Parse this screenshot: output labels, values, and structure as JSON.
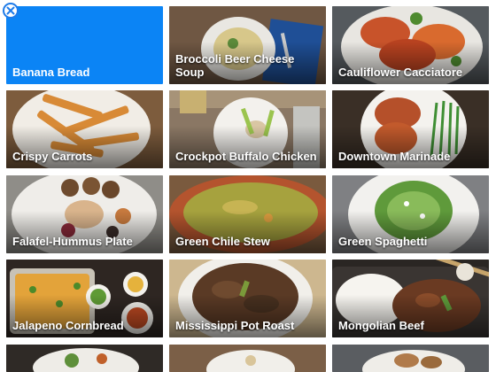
{
  "close_icon_name": "close-icon",
  "accent_color": "#0b84f5",
  "recipes": [
    {
      "label": "Banana Bread"
    },
    {
      "label": "Broccoli Beer Cheese Soup"
    },
    {
      "label": "Cauliflower Cacciatore"
    },
    {
      "label": "Crispy Carrots"
    },
    {
      "label": "Crockpot Buffalo Chicken"
    },
    {
      "label": "Downtown Marinade"
    },
    {
      "label": "Falafel-Hummus Plate"
    },
    {
      "label": "Green Chile Stew"
    },
    {
      "label": "Green Spaghetti"
    },
    {
      "label": "Jalapeno Cornbread"
    },
    {
      "label": "Mississippi Pot Roast"
    },
    {
      "label": "Mongolian Beef"
    },
    {
      "label": ""
    },
    {
      "label": ""
    },
    {
      "label": ""
    }
  ],
  "selected_index": 0
}
